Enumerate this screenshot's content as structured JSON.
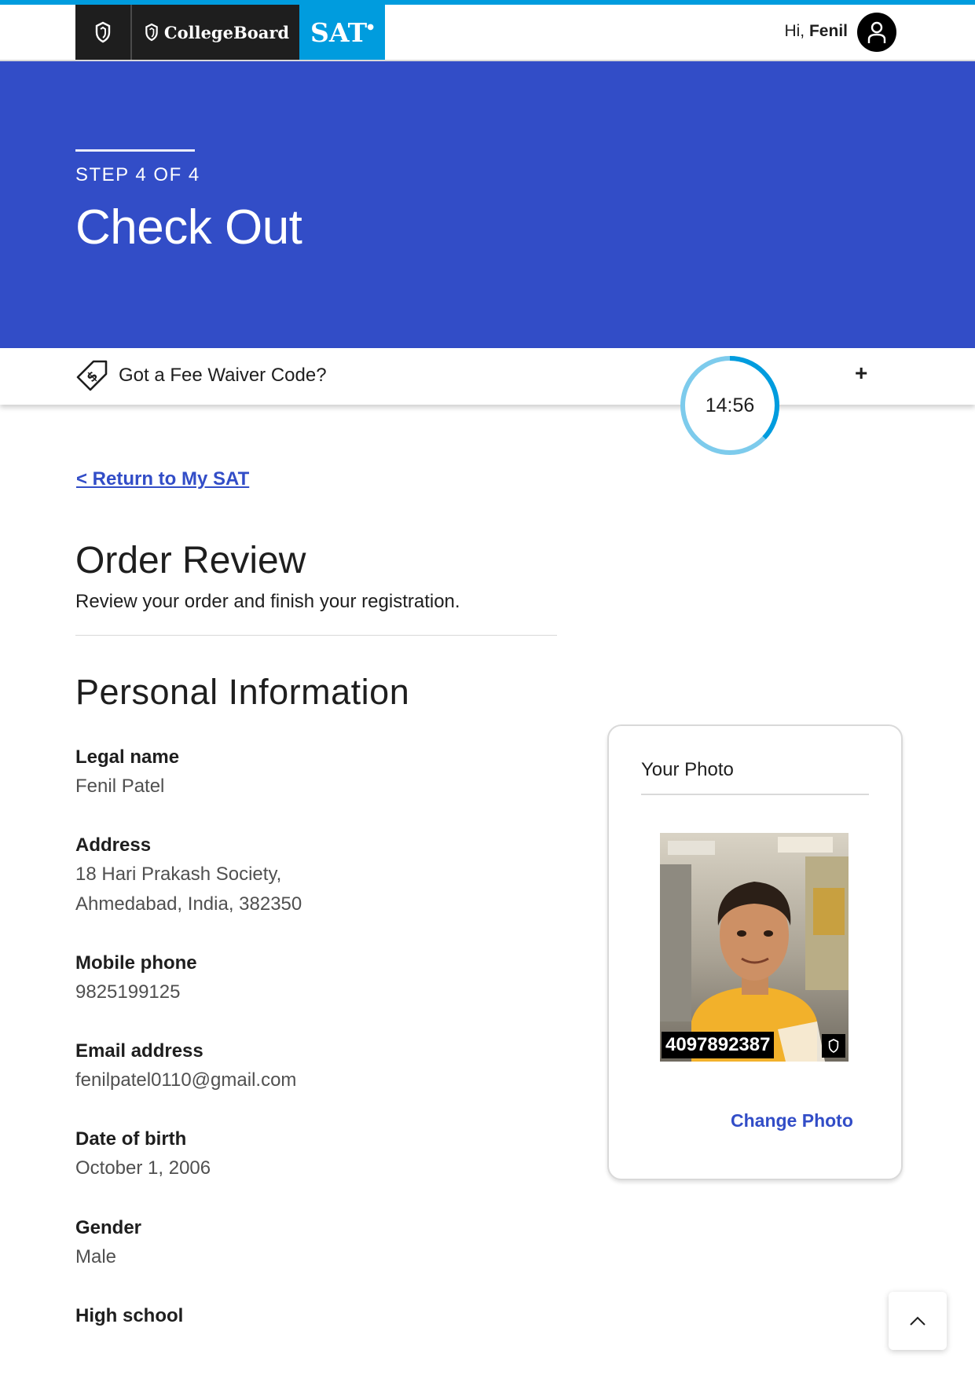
{
  "header": {
    "brand": "CollegeBoard",
    "product": "SAT",
    "greeting": "Hi,",
    "user_name": "Fenil"
  },
  "hero": {
    "step": "STEP 4 OF 4",
    "title": "Check Out"
  },
  "fee_waiver": {
    "label": "Got a Fee Waiver Code?",
    "expand_symbol": "+"
  },
  "timer": {
    "value": "14:56",
    "progress_fraction": 0.37
  },
  "nav": {
    "return_link": "< Return to My SAT"
  },
  "order_review": {
    "heading": "Order Review",
    "subtext": "Review your order and finish your registration."
  },
  "personal": {
    "heading": "Personal Information",
    "legal_name_label": "Legal name",
    "legal_name": "Fenil Patel",
    "address_label": "Address",
    "address_line1": "18 Hari Prakash Society,",
    "address_line2": "Ahmedabad, India, 382350",
    "mobile_label": "Mobile phone",
    "mobile": "9825199125",
    "email_label": "Email address",
    "email": "fenilpatel0110@gmail.com",
    "dob_label": "Date of birth",
    "dob": "October 1, 2006",
    "gender_label": "Gender",
    "gender": "Male",
    "high_school_label": "High school"
  },
  "photo_card": {
    "title": "Your Photo",
    "photo_id": "4097892387",
    "change_link": "Change Photo"
  },
  "colors": {
    "brand_blue": "#324dc7",
    "accent_cyan": "#009cde",
    "header_dark": "#1e1e1e"
  }
}
